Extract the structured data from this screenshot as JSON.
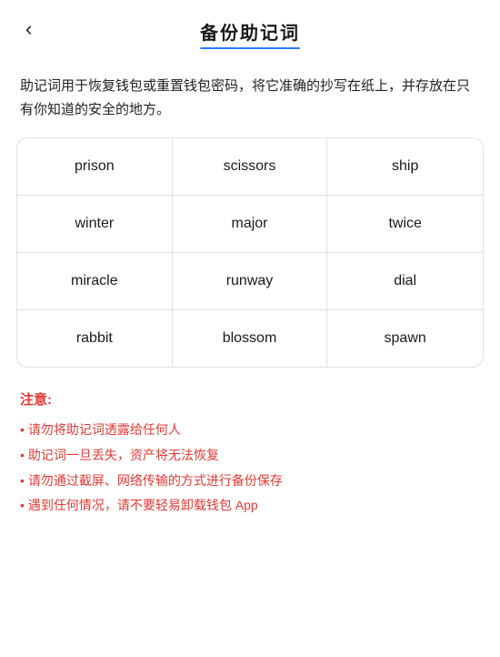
{
  "header": {
    "back_label": "‹",
    "title": "备份助记词"
  },
  "description": "助记词用于恢复钱包或重置钱包密码，将它准确的抄写在纸上，并存放在只有你知道的安全的地方。",
  "mnemonic": {
    "words": [
      "prison",
      "scissors",
      "ship",
      "winter",
      "major",
      "twice",
      "miracle",
      "runway",
      "dial",
      "rabbit",
      "blossom",
      "spawn"
    ]
  },
  "notice": {
    "title": "注意:",
    "items": [
      "请勿将助记词透露给任何人",
      "助记词一旦丢失，资产将无法恢复",
      "请勿通过截屏、网络传输的方式进行备份保存",
      "遇到任何情况，请不要轻易卸载钱包 App"
    ],
    "bullet": "•"
  }
}
